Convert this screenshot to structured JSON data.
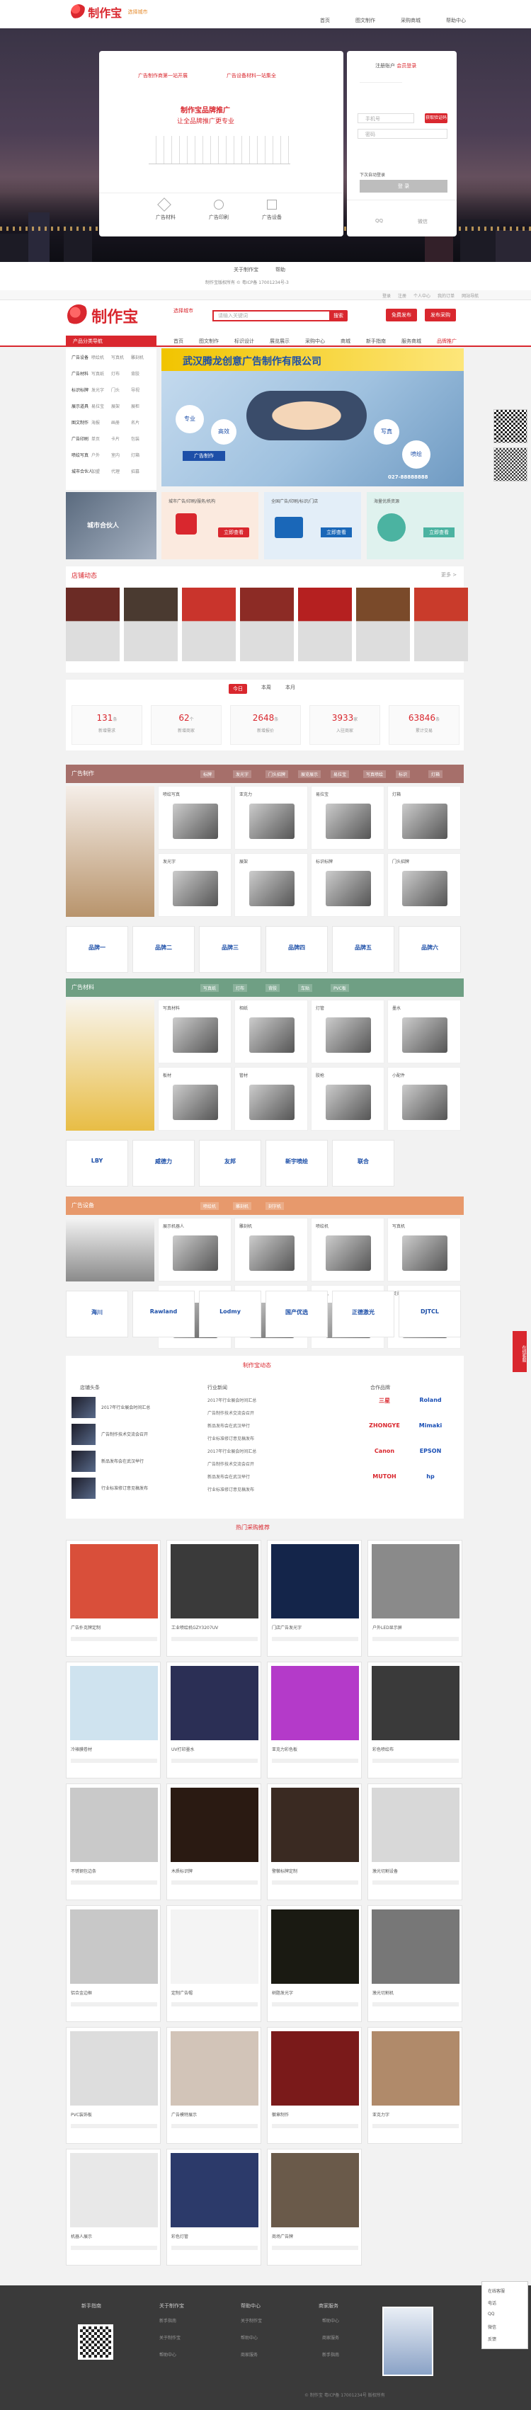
{
  "brand": {
    "name": "制作宝",
    "domain": "zhizuobao.com",
    "tag": "选择城市"
  },
  "topnav": [
    "首页",
    "图文制作",
    "采购商城",
    "帮助中心"
  ],
  "hero": {
    "main_steps": [
      "广告制作商第一站开展",
      "广告设备材料一站集全"
    ],
    "slogan": "制作宝品牌推广",
    "sub": "让全品牌推广更专业",
    "features": [
      "广告材料",
      "广告印刷",
      "广告设备"
    ],
    "login": {
      "tabs": [
        "注册账户",
        "会员登录"
      ],
      "user_placeholder": "手机号",
      "sms": "获取验证码",
      "pwd_placeholder": "密码",
      "remember": "下次自动登录",
      "btn": "登 录",
      "sns": [
        "QQ",
        "微信"
      ]
    }
  },
  "footer_links": [
    "关于制作宝",
    "帮助",
    "版权"
  ],
  "footer_note": "制作宝版权所有 © 粤ICP备 17001234号-3",
  "site_top": {
    "links": [
      "登录",
      "注册",
      "个人中心",
      "我的订单",
      "网站导航"
    ]
  },
  "site_header": {
    "search_placeholder": "请输入关键词",
    "search_btn": "搜索",
    "btn1": "免费发布",
    "btn2": "发布采购"
  },
  "catnav": [
    "产品分类导航",
    "首页",
    "图文制作",
    "标识设计",
    "展览展示",
    "采购中心",
    "商城",
    "新手指南",
    "服务商城",
    "入驻商家",
    "品牌推广"
  ],
  "sidebar": [
    [
      "广告设备",
      "喷绘机",
      "写真机",
      "雕刻机"
    ],
    [
      "广告材料",
      "写真纸",
      "灯布",
      "背胶"
    ],
    [
      "标识标牌",
      "发光字",
      "门头",
      "导视"
    ],
    [
      "展示道具",
      "易拉宝",
      "展架",
      "展柜"
    ],
    [
      "图文制作",
      "海报",
      "画册",
      "名片"
    ],
    [
      "广告印刷",
      "单页",
      "卡片",
      "包装"
    ],
    [
      "喷绘写真",
      "户外",
      "室内",
      "灯箱"
    ],
    [
      "城市合伙人",
      "加盟",
      "代理",
      "招募"
    ]
  ],
  "banner": {
    "title": "武汉腾龙创意广告制作有限公司",
    "chips": [
      "专业",
      "高效",
      "写真",
      "喷绘",
      "广告制作"
    ],
    "phone": "027-88888888"
  },
  "promo": [
    "城市合伙人",
    "城市广告/印刷/服务/机构",
    "全国广告/印刷/标识/门店",
    "海量优质资源"
  ],
  "promo_btn": "立即查看",
  "stores": {
    "title": "店铺动态",
    "more": "更多 >"
  },
  "stats": {
    "tabs": [
      "今日",
      "本周",
      "本月"
    ],
    "items": [
      {
        "v": "131",
        "u": "条"
      },
      {
        "v": "62",
        "u": "个"
      },
      {
        "v": "2648",
        "u": "条"
      },
      {
        "v": "3933",
        "u": "家"
      },
      {
        "v": "63846",
        "u": "条"
      }
    ],
    "labels": [
      "新增需求",
      "新增商家",
      "新增报价",
      "入驻商家",
      "累计交易"
    ]
  },
  "cat1": {
    "title": "广告制作",
    "tags": [
      "标牌",
      "发光字",
      "门头招牌",
      "展览展示",
      "易拉宝",
      "写真喷绘",
      "标识",
      "灯箱"
    ],
    "items": [
      "喷绘写真",
      "亚克力",
      "易拉宝",
      "灯箱",
      "发光字",
      "展架",
      "标识标牌",
      "门头招牌"
    ],
    "brands": [
      "品牌一",
      "品牌二",
      "品牌三",
      "品牌四",
      "品牌五",
      "品牌六"
    ]
  },
  "cat2": {
    "title": "广告材料",
    "tags": [
      "写真纸",
      "灯布",
      "背胶",
      "车贴",
      "PVC板"
    ],
    "items": [
      "写真材料",
      "相纸",
      "灯管",
      "墨水",
      "板材",
      "管材",
      "胶枪",
      "小配件"
    ],
    "brands": [
      "LBY",
      "威德力",
      "友邦",
      "新宇喷绘",
      "联合"
    ]
  },
  "cat3": {
    "title": "广告设备",
    "tags": [
      "喷绘机",
      "雕刻机",
      "刻字机"
    ],
    "items": [
      "展示机器人",
      "雕刻机",
      "喷绘机",
      "写真机",
      "切割机",
      "吹塑机",
      "激光机",
      "熨烫机"
    ],
    "brands": [
      "海川",
      "Rawland",
      "Lodmy",
      "国产优选",
      "正德激光",
      "DJTCL"
    ]
  },
  "news": {
    "title": "制作宝动态",
    "cols": [
      "店铺头条",
      "行业新闻",
      "合作品牌"
    ],
    "lines": [
      "2017年行业展会时间汇总",
      "广告制作技术交流会召开",
      "新品发布会在武汉举行",
      "行业标准修订意见稿发布"
    ],
    "brands": [
      "三星",
      "Roland",
      "ZHONGYE",
      "Mimaki",
      "Canon",
      "EPSON",
      "MUTOH",
      "hp"
    ]
  },
  "hot": {
    "title": "热门采购推荐",
    "items": [
      "广告扑克牌定制",
      "工业喷绘机GZY3207UV",
      "门店广告发光字",
      "户外LED显示屏",
      "冷裱膜卷材",
      "UV打印墨水",
      "亚克力彩色板",
      "彩色喷绘布",
      "不锈钢包边条",
      "木质标识牌",
      "警徽标牌定制",
      "激光切割设备",
      "铝合金边框",
      "定制广告帽",
      "树脂发光字",
      "激光切割机",
      "PVC装饰板",
      "广告模特展示",
      "徽章制作",
      "亚克力字",
      "机器人展示",
      "彩色灯管",
      "商场广告牌"
    ]
  },
  "footer": {
    "cols": [
      "新手指南",
      "关于制作宝",
      "帮助中心",
      "商家服务"
    ],
    "copy": "© 制作宝 粤ICP备 17001234号 版权所有"
  },
  "float": {
    "items": [
      "在线客服",
      "电话",
      "QQ",
      "微信",
      "反馈"
    ],
    "tab": "在线客服"
  }
}
